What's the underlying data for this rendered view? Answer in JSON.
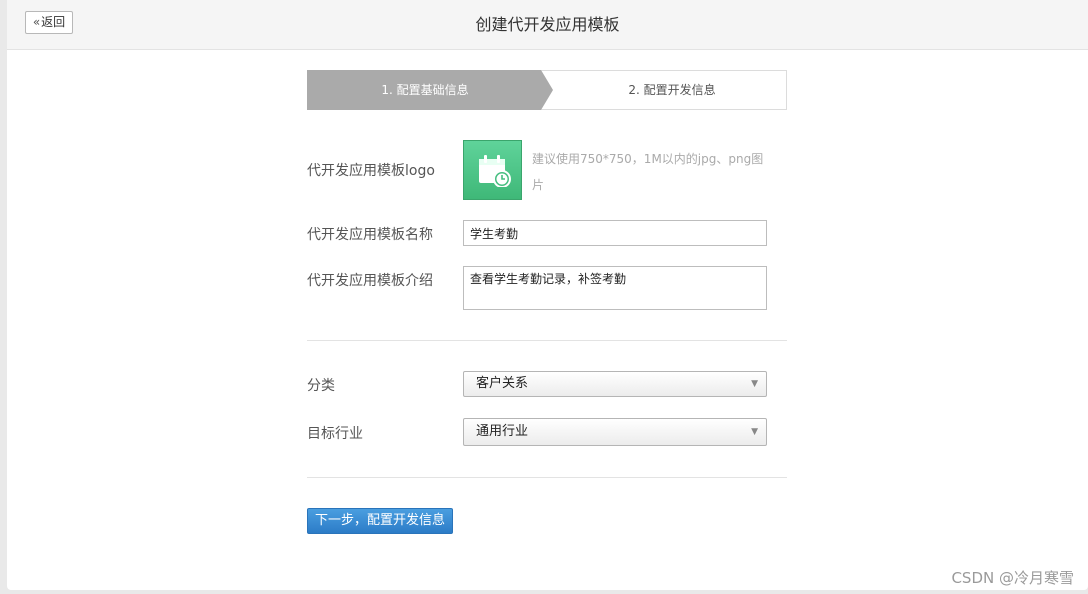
{
  "header": {
    "back_label": "返回",
    "title": "创建代开发应用模板"
  },
  "steps": [
    {
      "label": "1. 配置基础信息",
      "active": true
    },
    {
      "label": "2. 配置开发信息",
      "active": false
    }
  ],
  "form": {
    "logo_label": "代开发应用模板logo",
    "logo_icon": "calendar-clock-icon",
    "logo_hint": "建议使用750*750，1M以内的jpg、png图片",
    "name_label": "代开发应用模板名称",
    "name_value": "学生考勤",
    "intro_label": "代开发应用模板介绍",
    "intro_value": "查看学生考勤记录，补签考勤",
    "category_label": "分类",
    "category_value": "客户关系",
    "industry_label": "目标行业",
    "industry_value": "通用行业"
  },
  "actions": {
    "next_label": "下一步，配置开发信息"
  },
  "watermark": "CSDN @冷月寒雪",
  "colors": {
    "step_active": "#aaaaaa",
    "logo_green": "#4cc487",
    "primary": "#2f83cd"
  }
}
